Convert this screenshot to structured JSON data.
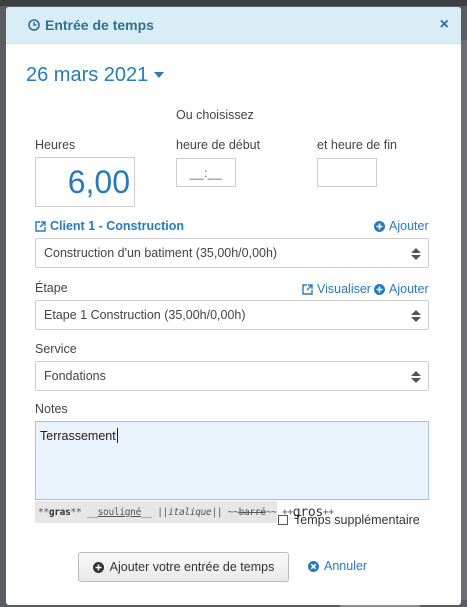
{
  "modal": {
    "title": "Entrée de temps",
    "close": "×"
  },
  "date": {
    "label": "26 mars 2021"
  },
  "time": {
    "or_choose": "Ou choisissez",
    "hours_label": "Heures",
    "hours_value": "6,00",
    "start_label": "heure de début",
    "start_value": "__:__",
    "end_label": "et heure de fin",
    "end_value": ""
  },
  "client": {
    "link": "Client 1 - Construction",
    "add": "Ajouter",
    "project_select": "Construction d'un batiment (35,00h/0,00h)"
  },
  "step": {
    "label": "Étape",
    "view": "Visualiser",
    "add": "Ajouter",
    "select": "Etape 1 Construction (35,00h/0,00h)"
  },
  "service": {
    "label": "Service",
    "select": "Fondations"
  },
  "notes": {
    "label": "Notes",
    "value": "Terrassement"
  },
  "markdown_hint": {
    "bold_pre": "**",
    "bold": "gras",
    "bold_post": "**",
    "under_pre": "__",
    "under": "souligné",
    "under_post": "__",
    "ital_pre": "||",
    "ital": "italique",
    "ital_post": "||",
    "strike_pre": "~~",
    "strike": "barré",
    "strike_post": "~~",
    "big_pre": "++",
    "big": "gros",
    "big_post": "++"
  },
  "overtime": {
    "label": "Temps supplémentaire"
  },
  "actions": {
    "submit": "Ajouter votre entrée de temps",
    "cancel": "Annuler"
  },
  "colors": {
    "accent": "#2a7ab8",
    "header_bg": "#d9edf7",
    "header_text": "#31708f"
  }
}
